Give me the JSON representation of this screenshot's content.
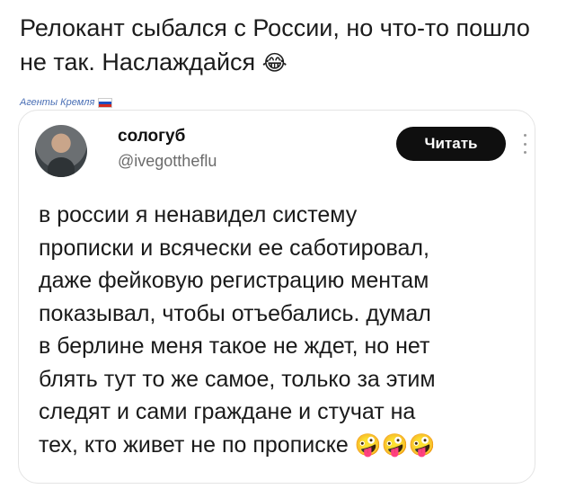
{
  "caption": {
    "text": "Релокант сыбался с России, но что-то пошло не так. Наслаждайся",
    "emoji": "😂"
  },
  "watermark": {
    "text": "Агенты Кремля",
    "flag_colors": [
      "#ffffff",
      "#1f4fbf",
      "#d52b1e"
    ]
  },
  "tweet": {
    "author_name": "сологуб",
    "author_handle": "@ivegottheflu",
    "follow_label": "Читать",
    "body": "в россии я ненавидел систему\nпрописки и всячески ее саботировал,\nдаже фейковую регистрацию ментам\nпоказывал, чтобы отъебались. думал\nв берлине меня такое не ждет, но нет\nблять тут то же самое, только за этим\nследят и сами граждане и стучат на\nтех, кто живет не по прописке ",
    "emojis": "🤪🤪🤪"
  },
  "colors": {
    "follow_button_bg": "#0f0f0f",
    "handle_gray": "#6b6b6b",
    "watermark_blue": "#4a6fb5"
  }
}
